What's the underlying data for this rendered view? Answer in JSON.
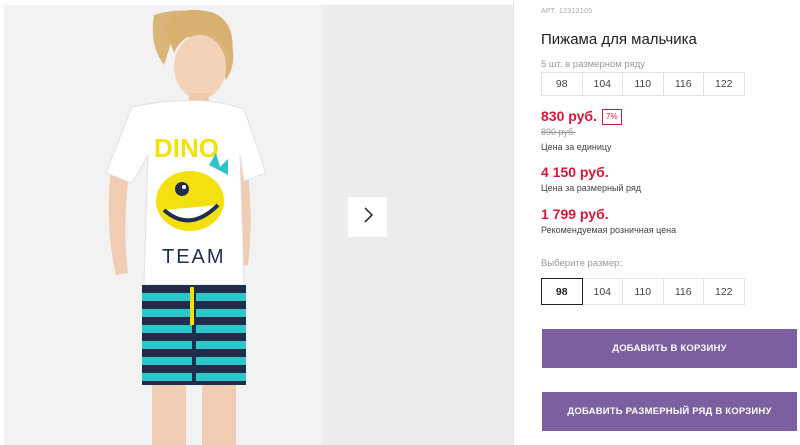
{
  "product": {
    "sku": "АРТ. 12312105",
    "title": "Пижама для мальчика",
    "tshirt_print_top": "DINO",
    "tshirt_print_bottom": "TEAM"
  },
  "pack": {
    "label": "5 шт. в размерном ряду",
    "sizes": [
      "98",
      "104",
      "110",
      "116",
      "122"
    ]
  },
  "prices": {
    "unit_price": "830 руб.",
    "discount": "7%",
    "old_price": "890 руб.",
    "unit_caption": "Цена за единицу",
    "pack_price": "4 150 руб.",
    "pack_caption": "Цена за размерный ряд",
    "retail_price": "1 799 руб.",
    "retail_caption": "Рекомендуемая розничная цена"
  },
  "size_select": {
    "label": "Выберите размер:",
    "sizes": [
      "98",
      "104",
      "110",
      "116",
      "122"
    ],
    "selected": "98"
  },
  "buttons": {
    "add_to_cart": "ДОБАВИТЬ В КОРЗИНУ",
    "add_pack_to_cart": "ДОБАВИТЬ РАЗМЕРНЫЙ РЯД В КОРЗИНУ"
  },
  "colors": {
    "price_red": "#d8163b",
    "button_purple": "#7b5f9e",
    "stripe_teal": "#2ec4c8",
    "stripe_navy": "#1f2e4d",
    "print_yellow": "#f2e10f"
  },
  "icons": {
    "next": "chevron-right-icon"
  }
}
